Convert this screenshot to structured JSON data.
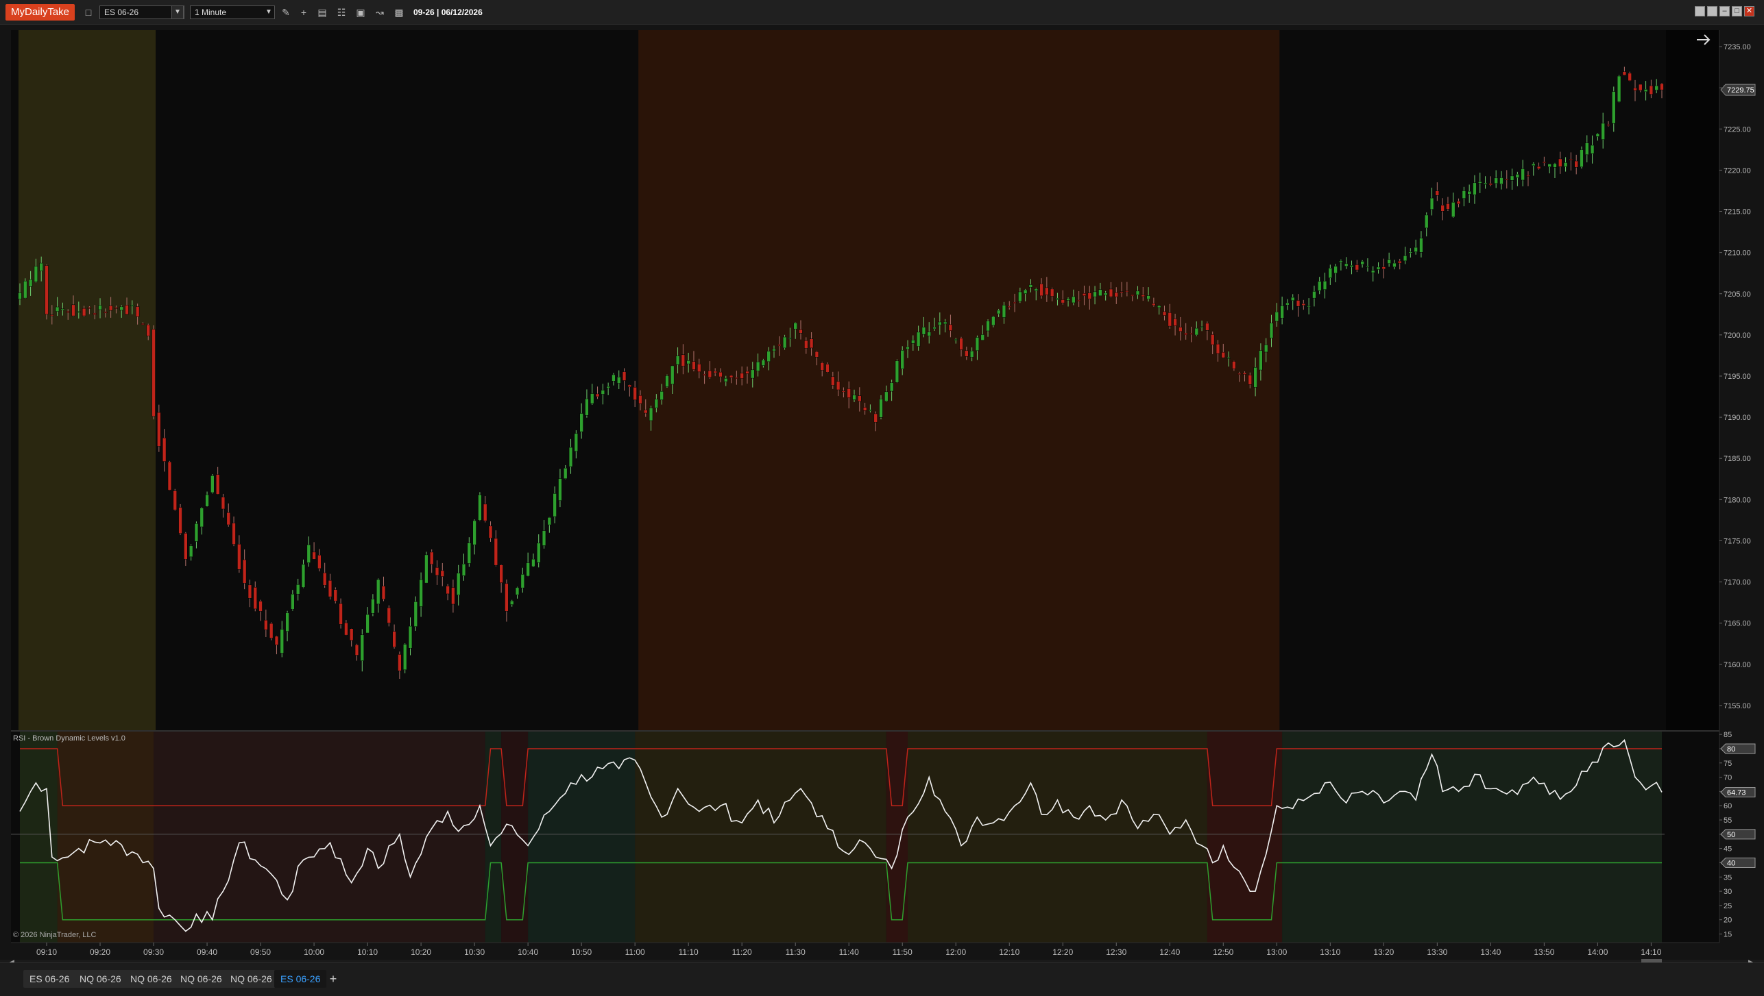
{
  "app": {
    "brand": "MyDailyTake",
    "instrument": "ES 06-26",
    "interval": "1 Minute",
    "title": "09-26 | 06/12/2026",
    "window_controls": [
      "restore-icon",
      "tile-icon",
      "minimize-icon",
      "maximize-icon",
      "close-icon"
    ],
    "toolbar_icons": [
      "bar-type-icon",
      "drawing-tool-icon",
      "crosshair-icon",
      "data-box-icon",
      "chart-properties-icon",
      "zoom-icon",
      "strategies-icon",
      "snapshot-icon"
    ]
  },
  "price_panel": {
    "y_labels": [
      "7235.00",
      "7230.00",
      "7225.00",
      "7220.00",
      "7215.00",
      "7210.00",
      "7205.00",
      "7200.00",
      "7195.00",
      "7190.00",
      "7185.00",
      "7180.00",
      "7175.00",
      "7170.00",
      "7165.00",
      "7160.00",
      "7155.00"
    ],
    "y_values": [
      7235,
      7230,
      7225,
      7220,
      7215,
      7210,
      7205,
      7200,
      7195,
      7190,
      7185,
      7180,
      7175,
      7170,
      7165,
      7160,
      7155
    ],
    "current_price_label": "7229.75",
    "current_price": 7229.75,
    "nav_arrow_icon": "arrow-right-icon"
  },
  "rsi_panel": {
    "title": "RSI - Brown Dynamic Levels v1.0",
    "y_labels": [
      "85",
      "80",
      "75",
      "70",
      "65",
      "60",
      "55",
      "50",
      "45",
      "40",
      "35",
      "30",
      "25",
      "20",
      "15"
    ],
    "y_values": [
      85,
      80,
      75,
      70,
      65,
      60,
      55,
      50,
      45,
      40,
      35,
      30,
      25,
      20,
      15
    ],
    "badges": [
      {
        "label": "80",
        "value": 80
      },
      {
        "label": "64.73",
        "value": 64.73
      },
      {
        "label": "50",
        "value": 50
      },
      {
        "label": "40",
        "value": 40
      }
    ],
    "copyright": "© 2026 NinjaTrader, LLC"
  },
  "x_axis": {
    "labels": [
      "09:10",
      "09:20",
      "09:30",
      "09:40",
      "09:50",
      "10:00",
      "10:10",
      "10:20",
      "10:30",
      "10:40",
      "10:50",
      "11:00",
      "11:10",
      "11:20",
      "11:30",
      "11:40",
      "11:50",
      "12:00",
      "12:10",
      "12:20",
      "12:30",
      "12:40",
      "12:50",
      "13:00",
      "13:10",
      "13:20",
      "13:30",
      "13:40",
      "13:50",
      "14:00",
      "14:10"
    ]
  },
  "tabs": [
    {
      "label": "ES 06-26",
      "active": false
    },
    {
      "label": "NQ 06-26",
      "active": false
    },
    {
      "label": "NQ 06-26",
      "active": false
    },
    {
      "label": "NQ 06-26",
      "active": false
    },
    {
      "label": "NQ 06-26",
      "active": false
    },
    {
      "label": "ES 06-26",
      "active": true
    }
  ],
  "colors": {
    "up": "#2ea02e",
    "down": "#c0241a",
    "rsi_line": "#f2f2f2",
    "upper_level": "#c0241a",
    "lower_level": "#2ea02e",
    "mid_level": "#555555",
    "session_morning": "#2a2710",
    "session_midday": "#2a1408",
    "panel_bg": "#0b0b0b"
  },
  "chart_data": [
    {
      "type": "candlestick",
      "title": "",
      "xlabel": "",
      "ylabel": "",
      "ylim": [
        7152,
        7237
      ],
      "anchors": [
        {
          "x": "09:05",
          "price": 7204
        },
        {
          "x": "09:10",
          "price": 7209
        },
        {
          "x": "09:11",
          "price": 7203
        },
        {
          "x": "09:20",
          "price": 7203
        },
        {
          "x": "09:27",
          "price": 7203
        },
        {
          "x": "09:30",
          "price": 7200
        },
        {
          "x": "09:31",
          "price": 7190
        },
        {
          "x": "09:37",
          "price": 7173
        },
        {
          "x": "09:42",
          "price": 7183
        },
        {
          "x": "09:48",
          "price": 7170
        },
        {
          "x": "09:54",
          "price": 7162
        },
        {
          "x": "10:00",
          "price": 7174
        },
        {
          "x": "10:05",
          "price": 7167
        },
        {
          "x": "10:09",
          "price": 7161
        },
        {
          "x": "10:13",
          "price": 7170
        },
        {
          "x": "10:17",
          "price": 7159
        },
        {
          "x": "10:22",
          "price": 7173
        },
        {
          "x": "10:27",
          "price": 7168
        },
        {
          "x": "10:32",
          "price": 7180
        },
        {
          "x": "10:37",
          "price": 7167
        },
        {
          "x": "10:42",
          "price": 7173
        },
        {
          "x": "10:47",
          "price": 7182
        },
        {
          "x": "10:52",
          "price": 7192
        },
        {
          "x": "10:58",
          "price": 7195
        },
        {
          "x": "11:03",
          "price": 7190
        },
        {
          "x": "11:09",
          "price": 7197
        },
        {
          "x": "11:16",
          "price": 7195
        },
        {
          "x": "11:22",
          "price": 7195
        },
        {
          "x": "11:31",
          "price": 7201
        },
        {
          "x": "11:38",
          "price": 7194
        },
        {
          "x": "11:46",
          "price": 7190
        },
        {
          "x": "11:51",
          "price": 7198
        },
        {
          "x": "11:58",
          "price": 7202
        },
        {
          "x": "12:03",
          "price": 7197
        },
        {
          "x": "12:08",
          "price": 7202
        },
        {
          "x": "12:15",
          "price": 7206
        },
        {
          "x": "12:21",
          "price": 7204
        },
        {
          "x": "12:27",
          "price": 7205
        },
        {
          "x": "12:34",
          "price": 7205
        },
        {
          "x": "12:38",
          "price": 7204
        },
        {
          "x": "12:43",
          "price": 7200
        },
        {
          "x": "12:47",
          "price": 7201
        },
        {
          "x": "12:50",
          "price": 7198
        },
        {
          "x": "12:56",
          "price": 7194
        },
        {
          "x": "13:00",
          "price": 7201
        },
        {
          "x": "13:02",
          "price": 7204
        },
        {
          "x": "13:07",
          "price": 7204
        },
        {
          "x": "13:12",
          "price": 7209
        },
        {
          "x": "13:20",
          "price": 7208
        },
        {
          "x": "13:27",
          "price": 7210
        },
        {
          "x": "13:30",
          "price": 7217
        },
        {
          "x": "13:33",
          "price": 7215
        },
        {
          "x": "13:38",
          "price": 7218
        },
        {
          "x": "13:45",
          "price": 7219
        },
        {
          "x": "13:52",
          "price": 7221
        },
        {
          "x": "13:57",
          "price": 7221
        },
        {
          "x": "14:03",
          "price": 7226
        },
        {
          "x": "14:05",
          "price": 7232
        },
        {
          "x": "14:08",
          "price": 7230
        },
        {
          "x": "14:12",
          "price": 7229.75
        }
      ]
    },
    {
      "type": "line",
      "title": "RSI - Brown Dynamic Levels v1.0",
      "ylim": [
        12,
        86
      ],
      "series": [
        {
          "name": "",
          "points": [
            {
              "x": "09:05",
              "y": 58
            },
            {
              "x": "09:08",
              "y": 68
            },
            {
              "x": "09:10",
              "y": 66
            },
            {
              "x": "09:11",
              "y": 42
            },
            {
              "x": "09:14",
              "y": 42
            },
            {
              "x": "09:16",
              "y": 45
            },
            {
              "x": "09:21",
              "y": 48
            },
            {
              "x": "09:27",
              "y": 43
            },
            {
              "x": "09:30",
              "y": 38
            },
            {
              "x": "09:31",
              "y": 24
            },
            {
              "x": "09:34",
              "y": 20
            },
            {
              "x": "09:36",
              "y": 16
            },
            {
              "x": "09:38",
              "y": 22
            },
            {
              "x": "09:41",
              "y": 20
            },
            {
              "x": "09:43",
              "y": 30
            },
            {
              "x": "09:46",
              "y": 47
            },
            {
              "x": "09:49",
              "y": 41
            },
            {
              "x": "09:52",
              "y": 36
            },
            {
              "x": "09:55",
              "y": 27
            },
            {
              "x": "09:58",
              "y": 41
            },
            {
              "x": "10:03",
              "y": 47
            },
            {
              "x": "10:07",
              "y": 33
            },
            {
              "x": "10:10",
              "y": 45
            },
            {
              "x": "10:12",
              "y": 38
            },
            {
              "x": "10:16",
              "y": 50
            },
            {
              "x": "10:18",
              "y": 35
            },
            {
              "x": "10:22",
              "y": 52
            },
            {
              "x": "10:25",
              "y": 58
            },
            {
              "x": "10:27",
              "y": 51
            },
            {
              "x": "10:31",
              "y": 60
            },
            {
              "x": "10:33",
              "y": 46
            },
            {
              "x": "10:37",
              "y": 53
            },
            {
              "x": "10:40",
              "y": 46
            },
            {
              "x": "10:44",
              "y": 58
            },
            {
              "x": "10:48",
              "y": 68
            },
            {
              "x": "10:54",
              "y": 73
            },
            {
              "x": "10:57",
              "y": 73
            },
            {
              "x": "11:00",
              "y": 76
            },
            {
              "x": "11:03",
              "y": 63
            },
            {
              "x": "11:05",
              "y": 56
            },
            {
              "x": "11:08",
              "y": 66
            },
            {
              "x": "11:12",
              "y": 58
            },
            {
              "x": "11:16",
              "y": 60
            },
            {
              "x": "11:20",
              "y": 54
            },
            {
              "x": "11:23",
              "y": 62
            },
            {
              "x": "11:26",
              "y": 54
            },
            {
              "x": "11:29",
              "y": 62
            },
            {
              "x": "11:31",
              "y": 66
            },
            {
              "x": "11:33",
              "y": 61
            },
            {
              "x": "11:36",
              "y": 52
            },
            {
              "x": "11:39",
              "y": 44
            },
            {
              "x": "11:42",
              "y": 48
            },
            {
              "x": "11:45",
              "y": 42
            },
            {
              "x": "11:48",
              "y": 38
            },
            {
              "x": "11:51",
              "y": 56
            },
            {
              "x": "11:55",
              "y": 70
            },
            {
              "x": "11:58",
              "y": 58
            },
            {
              "x": "12:01",
              "y": 46
            },
            {
              "x": "12:04",
              "y": 56
            },
            {
              "x": "12:07",
              "y": 54
            },
            {
              "x": "12:11",
              "y": 60
            },
            {
              "x": "12:14",
              "y": 68
            },
            {
              "x": "12:16",
              "y": 57
            },
            {
              "x": "12:19",
              "y": 62
            },
            {
              "x": "12:22",
              "y": 56
            },
            {
              "x": "12:25",
              "y": 60
            },
            {
              "x": "12:28",
              "y": 55
            },
            {
              "x": "12:31",
              "y": 62
            },
            {
              "x": "12:34",
              "y": 52
            },
            {
              "x": "12:37",
              "y": 57
            },
            {
              "x": "12:40",
              "y": 50
            },
            {
              "x": "12:43",
              "y": 55
            },
            {
              "x": "12:46",
              "y": 46
            },
            {
              "x": "12:48",
              "y": 40
            },
            {
              "x": "12:50",
              "y": 46
            },
            {
              "x": "12:53",
              "y": 37
            },
            {
              "x": "12:56",
              "y": 30
            },
            {
              "x": "12:58",
              "y": 43
            },
            {
              "x": "13:00",
              "y": 60
            },
            {
              "x": "13:03",
              "y": 59
            },
            {
              "x": "13:06",
              "y": 63
            },
            {
              "x": "13:09",
              "y": 68
            },
            {
              "x": "13:13",
              "y": 61
            },
            {
              "x": "13:16",
              "y": 65
            },
            {
              "x": "13:20",
              "y": 61
            },
            {
              "x": "13:23",
              "y": 65
            },
            {
              "x": "13:26",
              "y": 62
            },
            {
              "x": "13:29",
              "y": 78
            },
            {
              "x": "13:31",
              "y": 65
            },
            {
              "x": "13:34",
              "y": 65
            },
            {
              "x": "13:37",
              "y": 71
            },
            {
              "x": "13:39",
              "y": 66
            },
            {
              "x": "13:42",
              "y": 65
            },
            {
              "x": "13:45",
              "y": 64
            },
            {
              "x": "13:48",
              "y": 70
            },
            {
              "x": "13:51",
              "y": 64
            },
            {
              "x": "13:55",
              "y": 65
            },
            {
              "x": "13:58",
              "y": 72
            },
            {
              "x": "14:02",
              "y": 82
            },
            {
              "x": "14:05",
              "y": 83
            },
            {
              "x": "14:07",
              "y": 70
            },
            {
              "x": "14:10",
              "y": 67
            },
            {
              "x": "14:12",
              "y": 64.73
            }
          ]
        },
        {
          "name": "",
          "segments": [
            {
              "from": "09:05",
              "to": "09:12",
              "y": 80
            },
            {
              "from": "09:13",
              "to": "10:32",
              "y": 60
            },
            {
              "from": "10:33",
              "to": "10:35",
              "y": 80
            },
            {
              "from": "10:36",
              "to": "10:39",
              "y": 60
            },
            {
              "from": "10:40",
              "to": "11:47",
              "y": 80
            },
            {
              "from": "11:48",
              "to": "11:50",
              "y": 60
            },
            {
              "from": "11:51",
              "to": "12:47",
              "y": 80
            },
            {
              "from": "12:48",
              "to": "12:59",
              "y": 60
            },
            {
              "from": "13:00",
              "to": "14:12",
              "y": 80
            }
          ]
        },
        {
          "name": "",
          "segments": [
            {
              "from": "09:05",
              "to": "09:12",
              "y": 40
            },
            {
              "from": "09:13",
              "to": "10:32",
              "y": 20
            },
            {
              "from": "10:33",
              "to": "10:35",
              "y": 40
            },
            {
              "from": "10:36",
              "to": "10:39",
              "y": 20
            },
            {
              "from": "10:40",
              "to": "11:47",
              "y": 40
            },
            {
              "from": "11:48",
              "to": "11:50",
              "y": 20
            },
            {
              "from": "11:51",
              "to": "12:47",
              "y": 40
            },
            {
              "from": "12:48",
              "to": "12:59",
              "y": 20
            },
            {
              "from": "13:00",
              "to": "14:12",
              "y": 40
            }
          ]
        }
      ],
      "mid_level": 50
    }
  ]
}
